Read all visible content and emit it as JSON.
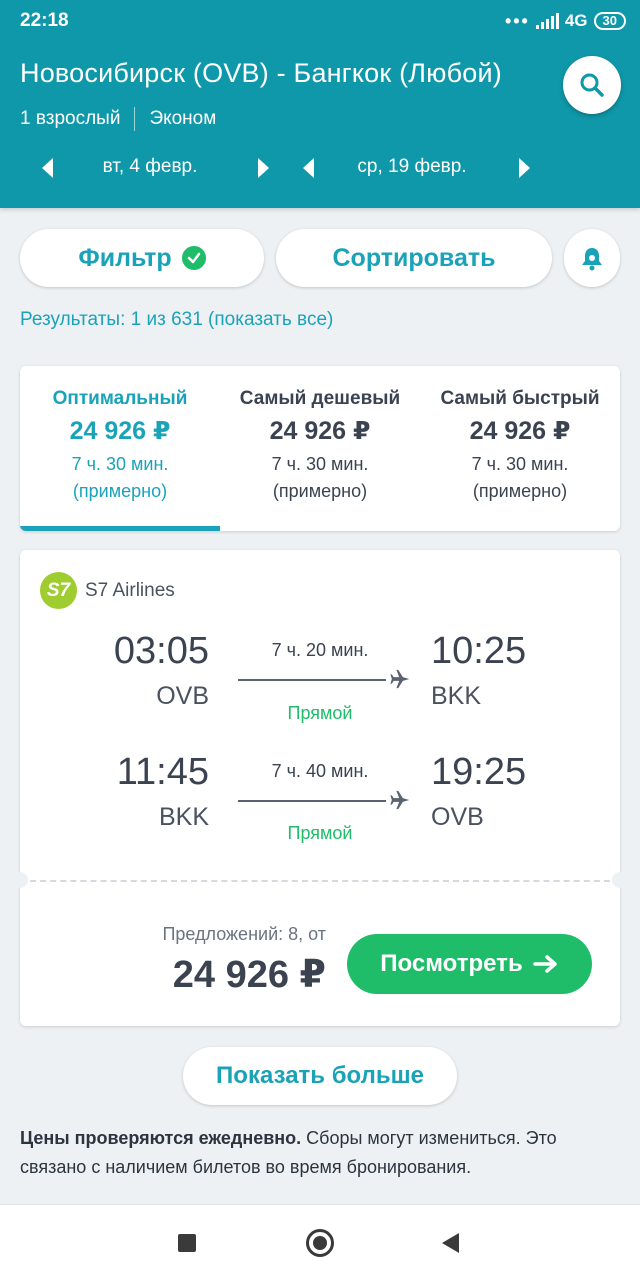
{
  "status": {
    "time": "22:18",
    "network": "4G",
    "battery": "30"
  },
  "header": {
    "route": "Новосибирск (OVB) - Бангкок (Любой)",
    "passengers": "1 взрослый",
    "cabin": "Эконом",
    "date_out": "вт, 4 февр.",
    "date_back": "ср, 19 февр."
  },
  "actions": {
    "filter": "Фильтр",
    "sort": "Сортировать"
  },
  "results": "Результаты: 1 из 631 (показать все)",
  "tabs": [
    {
      "label": "Оптимальный",
      "price": "24 926 ₽",
      "duration": "7 ч. 30 мин.",
      "approx": "(примерно)"
    },
    {
      "label": "Самый дешевый",
      "price": "24 926 ₽",
      "duration": "7 ч. 30 мин.",
      "approx": "(примерно)"
    },
    {
      "label": "Самый быстрый",
      "price": "24 926 ₽",
      "duration": "7 ч. 30 мин.",
      "approx": "(примерно)"
    }
  ],
  "ticket": {
    "airline_logo": "S7",
    "airline": "S7 Airlines",
    "segments": [
      {
        "dep_time": "03:05",
        "dep_code": "OVB",
        "duration": "7 ч. 20 мин.",
        "type": "Прямой",
        "arr_time": "10:25",
        "arr_code": "BKK"
      },
      {
        "dep_time": "11:45",
        "dep_code": "BKK",
        "duration": "7 ч. 40 мин.",
        "type": "Прямой",
        "arr_time": "19:25",
        "arr_code": "OVB"
      }
    ],
    "offers": "Предложений: 8, от",
    "price": "24 926 ₽",
    "view_button": "Посмотреть"
  },
  "show_more": "Показать больше",
  "note": {
    "bold": "Цены проверяются ежедневно.",
    "text": " Сборы могут измениться. Это связано с наличием билетов во время бронирования."
  },
  "colors": {
    "header": "#0f98a9",
    "accent": "#1aa3b8",
    "green": "#1fbd6a"
  }
}
